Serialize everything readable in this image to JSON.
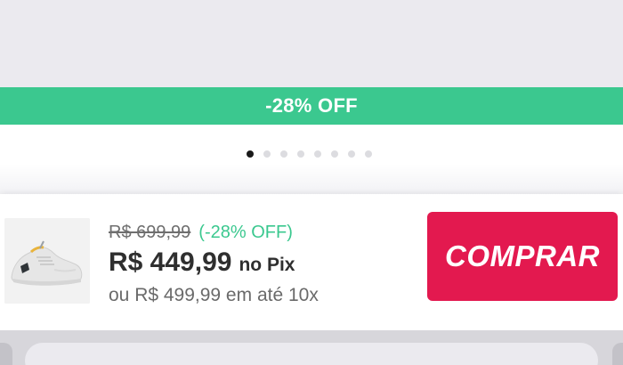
{
  "banner": {
    "discount_label": "-28% OFF"
  },
  "carousel": {
    "total_dots": 8,
    "active_index": 0
  },
  "buy_bar": {
    "product_image_icon": "sneaker-icon",
    "old_price": "R$ 699,99",
    "old_discount": "(-28% OFF)",
    "pix_price": "R$ 449,99",
    "pix_suffix": "no Pix",
    "installments": "ou R$ 499,99 em até 10x",
    "buy_label": "COMPRAR"
  },
  "colors": {
    "banner_green": "#3bc88f",
    "buy_red": "#e3194f",
    "discount_green": "#3bc88f"
  }
}
